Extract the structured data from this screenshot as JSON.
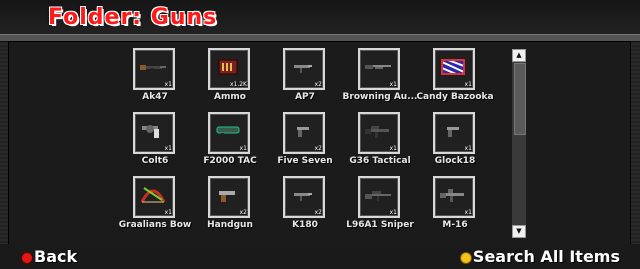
{
  "title": "Folder: Guns",
  "footer": {
    "back_label": "Back",
    "search_label": "Search All Items"
  },
  "scroll": {
    "up_glyph": "▲",
    "down_glyph": "▼"
  },
  "items": [
    {
      "name": "Ak47",
      "qty": "x1",
      "icon": "rifle-icon"
    },
    {
      "name": "Ammo",
      "qty": "x1.2K",
      "icon": "ammo-box-icon"
    },
    {
      "name": "AP7",
      "qty": "x2",
      "icon": "smg-icon"
    },
    {
      "name": "Browning Au...",
      "qty": "x1",
      "icon": "shotgun-icon"
    },
    {
      "name": "Candy Bazooka",
      "qty": "x1",
      "icon": "candy-bazooka-icon"
    },
    {
      "name": "Colt6",
      "qty": "x1",
      "icon": "revolver-icon"
    },
    {
      "name": "F2000 TAC",
      "qty": "x1",
      "icon": "bullpup-rifle-icon"
    },
    {
      "name": "Five Seven",
      "qty": "x2",
      "icon": "pistol-icon"
    },
    {
      "name": "G36 Tactical",
      "qty": "x1",
      "icon": "tactical-rifle-icon"
    },
    {
      "name": "Glock18",
      "qty": "x1",
      "icon": "pistol-icon"
    },
    {
      "name": "Graalians Bow",
      "qty": "x1",
      "icon": "bow-icon"
    },
    {
      "name": "Handgun",
      "qty": "x2",
      "icon": "handgun-icon"
    },
    {
      "name": "K180",
      "qty": "x2",
      "icon": "smg-icon"
    },
    {
      "name": "L96A1 Sniper",
      "qty": "x1",
      "icon": "sniper-rifle-icon"
    },
    {
      "name": "M-16",
      "qty": "x1",
      "icon": "assault-rifle-icon"
    }
  ]
}
